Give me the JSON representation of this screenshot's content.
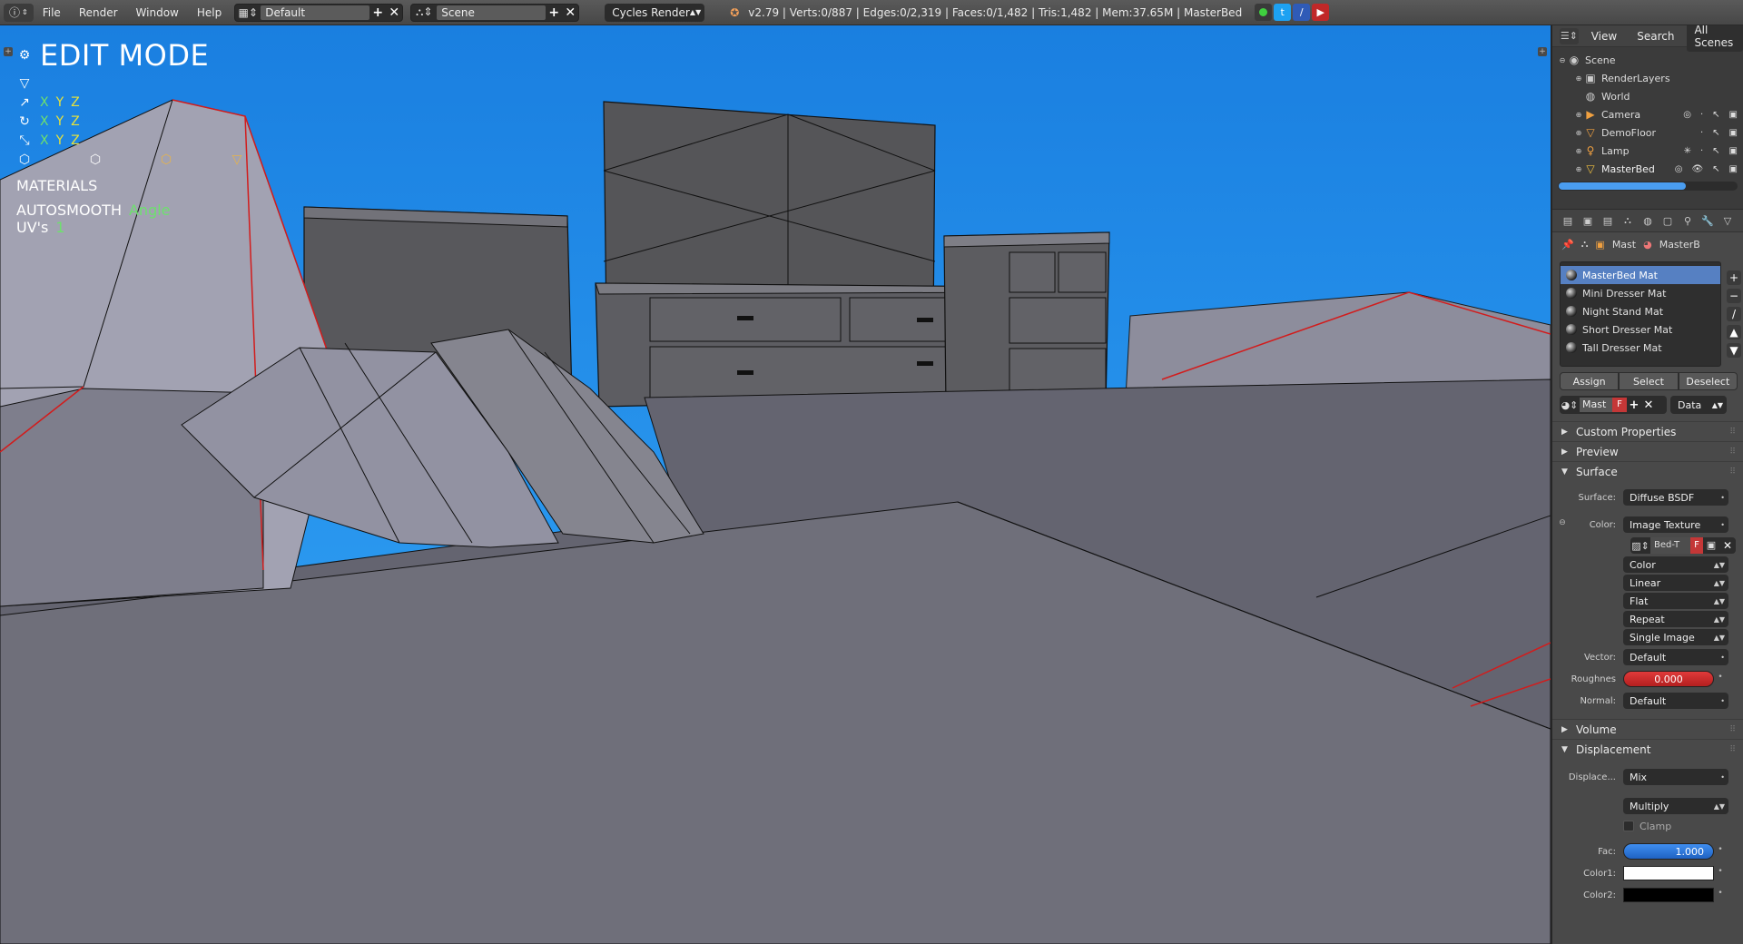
{
  "topbar": {
    "info_icon": "info-icon",
    "menus": [
      "File",
      "Render",
      "Window",
      "Help"
    ],
    "layout": {
      "value": "Default"
    },
    "scene": {
      "value": "Scene"
    },
    "engine": "Cycles Render",
    "stats": "v2.79 | Verts:0/887 | Edges:0/2,319 | Faces:0/1,482 | Tris:1,482 | Mem:37.65M | MasterBed"
  },
  "viewport": {
    "mode": "EDIT MODE",
    "materials_label": "MATERIALS",
    "autosmooth_label": "AUTOSMOOTH",
    "angle_label": "Angle",
    "uvs_label": "UV's",
    "uvs_count": "1",
    "coord_x": "X",
    "coord_y": "Y",
    "coord_z": "Z"
  },
  "outliner": {
    "header": {
      "view": "View",
      "search": "Search",
      "all_scenes": "All Scenes"
    },
    "items": [
      {
        "label": "Scene"
      },
      {
        "label": "RenderLayers"
      },
      {
        "label": "World"
      },
      {
        "label": "Camera"
      },
      {
        "label": "DemoFloor"
      },
      {
        "label": "Lamp"
      },
      {
        "label": "MasterBed"
      }
    ]
  },
  "properties": {
    "context": {
      "item1": "Mast",
      "item2": "MasterB"
    },
    "materials": [
      "MasterBed Mat",
      "Mini Dresser Mat",
      "Night Stand Mat",
      "Short Dresser Mat",
      "Tall Dresser Mat"
    ],
    "buttons": {
      "assign": "Assign",
      "select": "Select",
      "deselect": "Deselect"
    },
    "slot": {
      "name": "Mast",
      "fake": "F",
      "link": "Data"
    },
    "panels": {
      "custom_properties": "Custom Properties",
      "preview": "Preview",
      "surface": "Surface",
      "volume": "Volume",
      "displacement": "Displacement"
    },
    "surface": {
      "surface_label": "Surface:",
      "surface_value": "Diffuse BSDF",
      "color_label": "Color:",
      "color_value": "Image Texture",
      "tex_name": "Bed-T",
      "tex_fake": "F",
      "options": [
        "Color",
        "Linear",
        "Flat",
        "Repeat",
        "Single Image"
      ],
      "vector_label": "Vector:",
      "vector_value": "Default",
      "roughness_label": "Roughnes",
      "roughness_value": "0.000",
      "normal_label": "Normal:",
      "normal_value": "Default"
    },
    "displacement": {
      "displace_label": "Displace...",
      "displace_value": "Mix",
      "blend_value": "Multiply",
      "clamp_label": "Clamp",
      "fac_label": "Fac:",
      "fac_value": "1.000",
      "color1_label": "Color1:",
      "color2_label": "Color2:",
      "color1": "#ffffff",
      "color2": "#000000"
    }
  }
}
